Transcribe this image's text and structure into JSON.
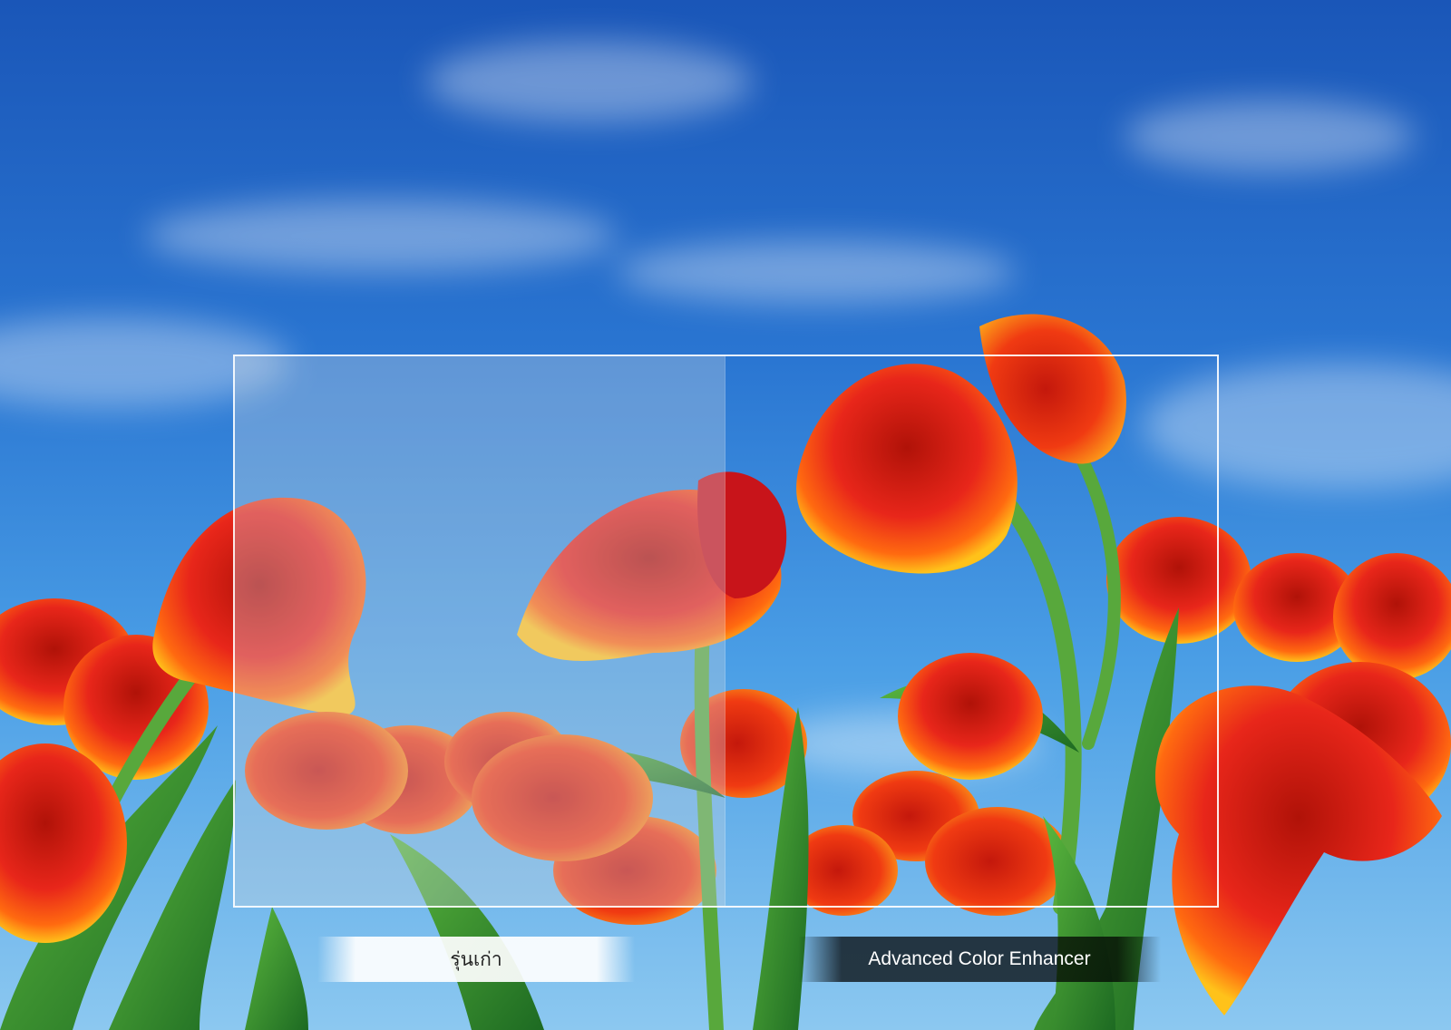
{
  "comparison": {
    "left_label": "รุ่นเก่า",
    "right_label": "Advanced Color Enhancer"
  },
  "colors": {
    "sky_top": "#1a56b8",
    "sky_mid": "#2f86db",
    "sky_low": "#6fb6ea",
    "petal_red": "#e8261a",
    "petal_orange": "#ff7a12",
    "petal_yellow": "#ffc21a",
    "leaf_green": "#2e8a2a",
    "stem_green": "#58a83c"
  }
}
